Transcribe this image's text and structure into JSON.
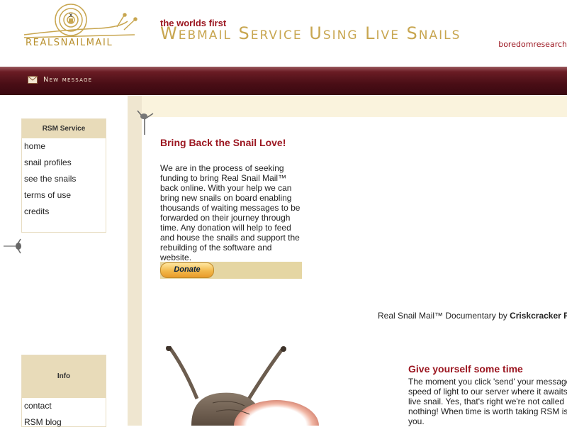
{
  "header": {
    "logo_text": "REALSNAILMAIL",
    "tagline_small": "the worlds first",
    "tagline_big": "Webmail Service Using Live Snails",
    "brand": "boredomresearch"
  },
  "nav": {
    "new_message": "New message",
    "icon": "envelope-icon"
  },
  "sidebar": {
    "service_title": "RSM Service",
    "service_items": [
      "home",
      "snail profiles",
      "see the snails",
      "terms of use",
      "credits"
    ],
    "info_title": "Info",
    "info_items": [
      "contact",
      "RSM blog"
    ]
  },
  "donate": {
    "title": "Bring Back the Snail Love!",
    "text": "We are in the process of seeking funding to bring Real Snail Mail™ back online. With your help we can bring new snails on board enabling thousands of waiting messages to be forwarded on their journey through time. Any donation will help to feed and house the snails and support the rebuilding of the software and website.",
    "button": "Donate"
  },
  "documentary": {
    "text": "Real Snail Mail™ Documentary by ",
    "author": "Criskcracker F"
  },
  "give_time": {
    "title": "Give yourself some time",
    "lines": [
      "The moment you click 'send' your message",
      "speed of light to our server where it awaits",
      "live snail. Yes, that's right we're not called",
      "nothing! When time is worth taking RSM is",
      "you."
    ]
  },
  "colors": {
    "accent_red": "#9b1620",
    "gold": "#c8a650",
    "nav_bg": "#4a0e16",
    "beige": "#e8dbb9"
  }
}
